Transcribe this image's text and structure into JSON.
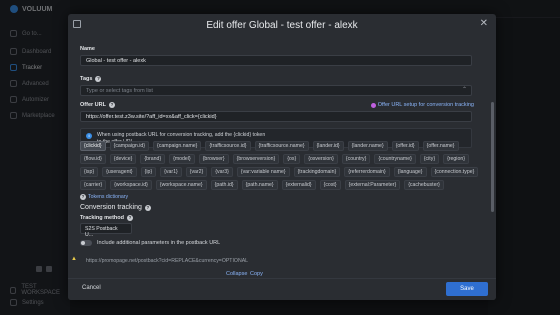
{
  "app": {
    "logo_text": "VOLUUM",
    "sidebar_items": [
      "Go to...",
      "Dashboard",
      "Tracker",
      "Advanced",
      "Automizer",
      "Marketplace"
    ],
    "bottom_items": [
      "TEST WORKSPACE",
      "Settings"
    ]
  },
  "modal": {
    "title": "Edit offer Global - test offer - alexk",
    "name_label": "Name",
    "name_value": "Global - test offer - alexk",
    "tags_label": "Tags",
    "tags_placeholder": "Type or select tags from list",
    "offer_url_label": "Offer URL",
    "offer_url_setup_link": "Offer URL setup for conversion tracking",
    "offer_url_value": "https://offer.test.z3w.site/?aff_id=xx&aff_click={clickid}",
    "info_text_line1": "When using postback URL for conversion tracking, add the {clickid} token",
    "info_text_line2": "to the offer URL.",
    "tokens": [
      "{clickid}",
      "{campaign.id}",
      "{campaign.name}",
      "{trafficsource.id}",
      "{trafficsource.name}",
      "{lander.id}",
      "{lander.name}",
      "{offer.id}",
      "{offer.name}",
      "{flow.id}",
      "{device}",
      "{brand}",
      "{model}",
      "{browser}",
      "{browserversion}",
      "{os}",
      "{osversion}",
      "{country}",
      "{countryname}",
      "{city}",
      "{region}",
      "{isp}",
      "{useragent}",
      "{ip}",
      "{var1}",
      "{var2}",
      "{var3}",
      "{var:variable name}",
      "{trackingdomain}",
      "{referrerdomain}",
      "{language}",
      "{connection.type}",
      "{carrier}",
      "{workspace.id}",
      "{workspace.name}",
      "{path.id}",
      "{path.name}",
      "{externalid}",
      "{cost}",
      "{external:Parameter}",
      "{cachebuster}"
    ],
    "tokens_dictionary_link": "Tokens dictionary",
    "conversion_tracking_title": "Conversion tracking",
    "tracking_method_label": "Tracking method",
    "tracking_method_value": "S2S Postback U...",
    "toggle_label": "Include additional parameters in the postback URL",
    "postback_url": "https://promopage.net/postback?cid=REPLACE&currency=OPTIONAL",
    "collapse_label": "Collapse",
    "copy_label": "Copy",
    "cancel_label": "Cancel",
    "save_label": "Save"
  }
}
